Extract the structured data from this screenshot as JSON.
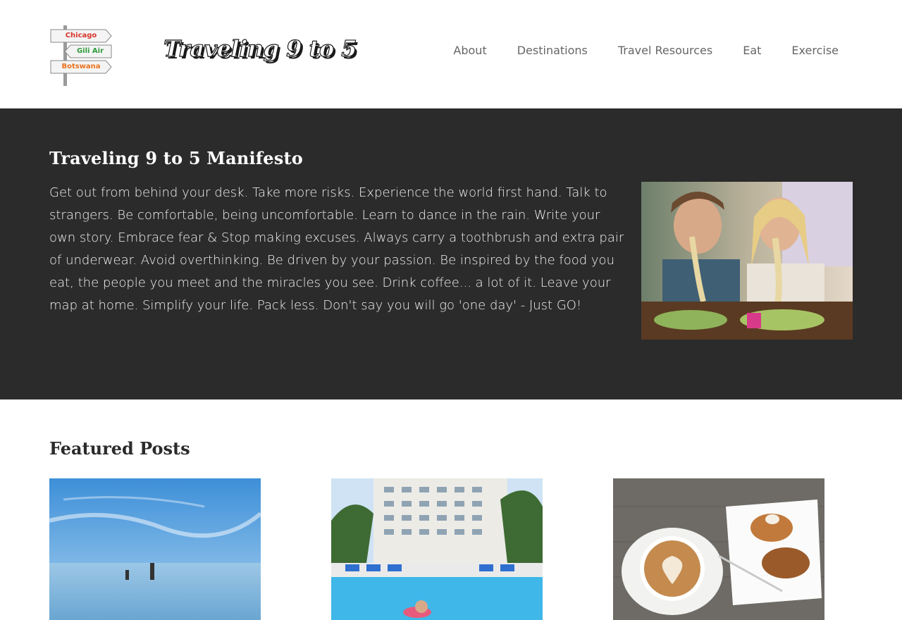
{
  "site": {
    "logo_text": "Traveling 9 to 5",
    "logo_signs": [
      "Chicago",
      "Gili Air",
      "Botswana"
    ]
  },
  "nav": {
    "items": [
      {
        "label": "About"
      },
      {
        "label": "Destinations"
      },
      {
        "label": "Travel Resources"
      },
      {
        "label": "Eat"
      },
      {
        "label": "Exercise"
      }
    ]
  },
  "manifesto": {
    "title": "Traveling 9 to 5 Manifesto",
    "body": "Get out from behind your desk. Take more risks. Experience the world first hand. Talk to strangers. Be comfortable, being uncomfortable. Learn to dance in the rain. Write your own story. Embrace fear & Stop making excuses. Always carry a toothbrush and extra pair of underwear. Avoid overthinking. Be driven by your passion. Be inspired by the food you eat, the people you meet and the miracles you see. Drink coffee... a lot of it. Leave your map at home. Simplify your life. Pack less. Don't say you will go 'one day' - Just GO!",
    "photo_icon": "noodle-eating-couple-photo"
  },
  "featured": {
    "title": "Featured Posts",
    "posts": [
      {
        "image_icon": "ocean-handstand-photo"
      },
      {
        "image_icon": "hotel-pool-photo"
      },
      {
        "image_icon": "coffee-and-pastry-photo"
      }
    ]
  },
  "colors": {
    "dark_band": "#2b2b2b",
    "nav_text": "#666666",
    "sign_red": "#d9342b",
    "sign_green": "#2e9a3a",
    "sign_orange": "#e8711c"
  }
}
